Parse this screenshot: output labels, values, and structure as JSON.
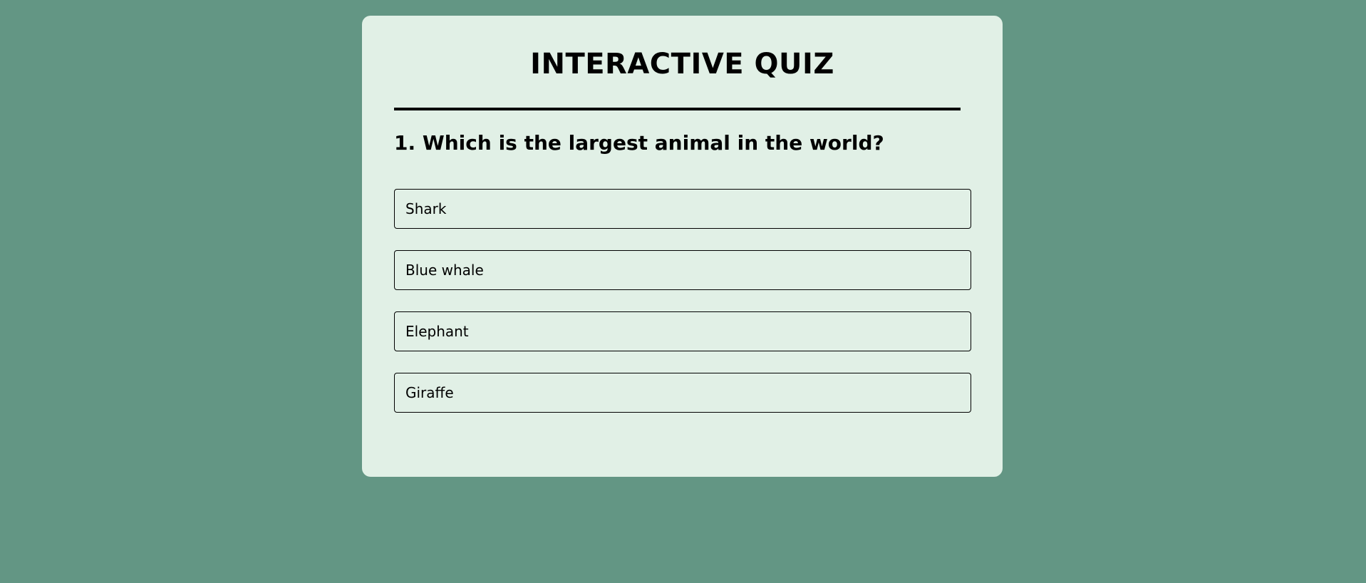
{
  "quiz": {
    "title": "INTERACTIVE QUIZ",
    "question": "1. Which is the largest animal in the world?",
    "options": [
      {
        "label": "Shark"
      },
      {
        "label": "Blue whale"
      },
      {
        "label": "Elephant"
      },
      {
        "label": "Giraffe"
      }
    ]
  },
  "colors": {
    "page_background": "#639684",
    "card_background": "#e1f0e6",
    "text": "#000000"
  }
}
